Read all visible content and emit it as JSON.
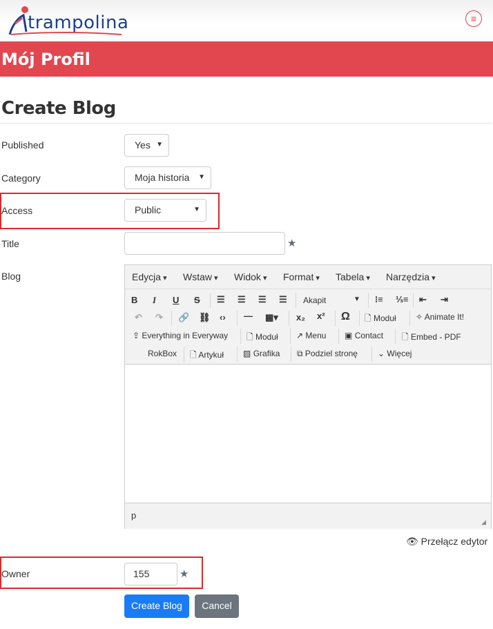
{
  "header": {
    "logo_text": "trampolina",
    "menu_icon": "hamburger-icon"
  },
  "banner": {
    "title": "Mój Profil"
  },
  "page": {
    "title": "Create Blog"
  },
  "form": {
    "published": {
      "label": "Published",
      "value": "Yes"
    },
    "category": {
      "label": "Category",
      "value": "Moja historia"
    },
    "access": {
      "label": "Access",
      "value": "Public"
    },
    "title": {
      "label": "Title",
      "value": ""
    },
    "blog": {
      "label": "Blog"
    },
    "owner": {
      "label": "Owner",
      "value": "155"
    }
  },
  "editor": {
    "menu": [
      "Edycja",
      "Wstaw",
      "Widok",
      "Format",
      "Tabela",
      "Narzędzia"
    ],
    "format_select": "Akapit",
    "buttons": {
      "modul": "Moduł",
      "animate": "Animate It!",
      "everything": "Everything in Everyway",
      "modul2": "Moduł",
      "menu": "Menu",
      "contact": "Contact",
      "embed": "Embed - PDF",
      "rokbox": "RokBox",
      "artykul": "Artykuł",
      "grafika": "Grafika",
      "podziel": "Podziel stronę",
      "wiecej": "Więcej"
    },
    "status_path": "p",
    "toggle_label": "Przełącz edytor"
  },
  "actions": {
    "create": "Create Blog",
    "cancel": "Cancel"
  },
  "colors": {
    "brand_red": "#e2474f",
    "primary": "#1a7cf5",
    "secondary": "#6c757d",
    "highlight": "#d92a2a"
  }
}
